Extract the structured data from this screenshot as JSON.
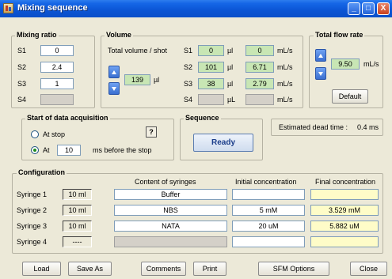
{
  "window": {
    "title": "Mixing sequence",
    "min_glyph": "_",
    "max_glyph": "□",
    "close_glyph": "X"
  },
  "mixing_ratio": {
    "title": "Mixing ratio",
    "rows": [
      {
        "label": "S1",
        "value": "0"
      },
      {
        "label": "S2",
        "value": "2.4"
      },
      {
        "label": "S3",
        "value": "1"
      },
      {
        "label": "S4",
        "value": ""
      }
    ]
  },
  "volume": {
    "title": "Volume",
    "total_label": "Total volume / shot",
    "total_value": "139",
    "total_unit": "µl",
    "rows": [
      {
        "label": "S1",
        "vol": "0",
        "vol_unit": "µl",
        "rate": "0",
        "rate_unit": "mL/s"
      },
      {
        "label": "S2",
        "vol": "101",
        "vol_unit": "µl",
        "rate": "6.71",
        "rate_unit": "mL/s"
      },
      {
        "label": "S3",
        "vol": "38",
        "vol_unit": "µl",
        "rate": "2.79",
        "rate_unit": "mL/s"
      },
      {
        "label": "S4",
        "vol": "",
        "vol_unit": "µL",
        "rate": "",
        "rate_unit": "mL/s"
      }
    ]
  },
  "flow_rate": {
    "title": "Total flow rate",
    "value": "9.50",
    "unit": "mL/s",
    "default_label": "Default"
  },
  "acquisition": {
    "title": "Start of data acquisition",
    "at_stop_label": "At stop",
    "at_label": "At",
    "at_value": "10",
    "at_suffix": "ms before the stop",
    "help_glyph": "?"
  },
  "sequence": {
    "title": "Sequence",
    "button_label": "Ready"
  },
  "dead_time": {
    "label": "Estimated dead time :",
    "value": "0.4 ms"
  },
  "configuration": {
    "title": "Configuration",
    "headers": {
      "content": "Content of syringes",
      "initial": "Initial concentration",
      "final": "Final concentration"
    },
    "syringes": [
      {
        "label": "Syringe 1",
        "size": "10 ml",
        "content": "Buffer",
        "initial": "",
        "final": ""
      },
      {
        "label": "Syringe 2",
        "size": "10 ml",
        "content": "NBS",
        "initial": "5 mM",
        "final": "3.529 mM"
      },
      {
        "label": "Syringe 3",
        "size": "10 ml",
        "content": "NATA",
        "initial": "20 uM",
        "final": "5.882 uM"
      },
      {
        "label": "Syringe 4",
        "size": "----",
        "content": "",
        "initial": "",
        "final": ""
      }
    ]
  },
  "footer": {
    "load": "Load",
    "save_as": "Save As",
    "comments": "Comments",
    "print": "Print",
    "sfm_options": "SFM Options",
    "close": "Close"
  },
  "colors": {
    "titlebar": "#0b55d4",
    "window_bg": "#ece9d8",
    "field_green": "#c8e6b4",
    "field_yellow": "#fefcc8"
  }
}
